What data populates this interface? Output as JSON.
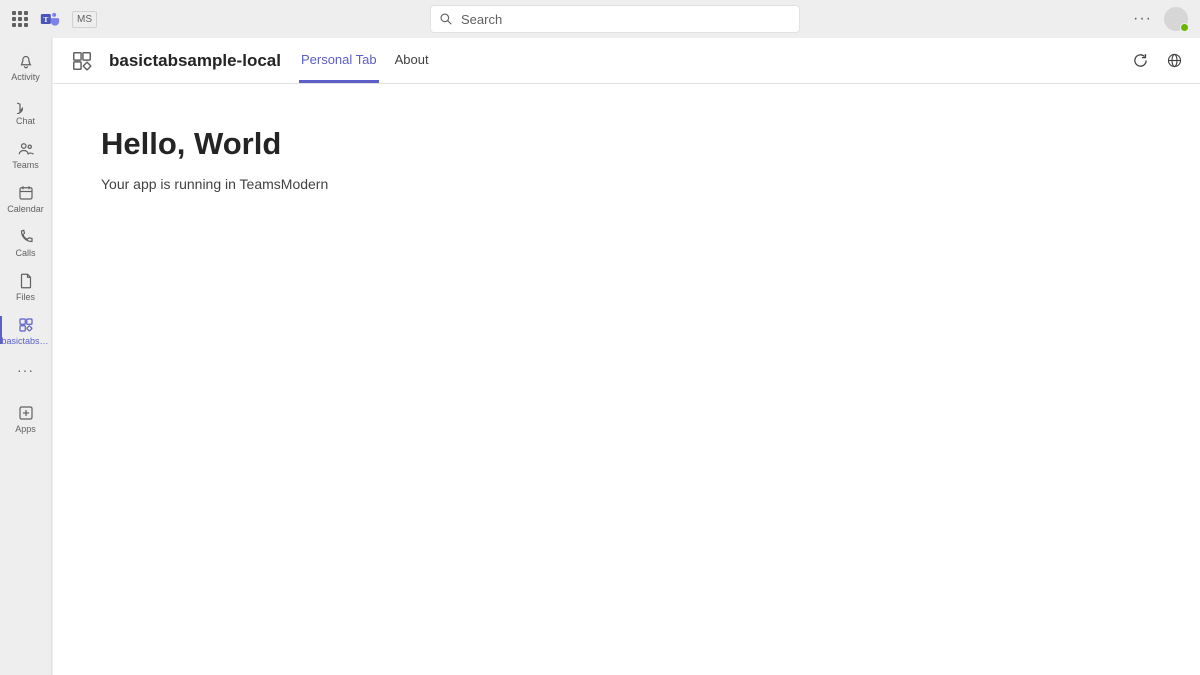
{
  "topbar": {
    "org_badge": "MS",
    "search_placeholder": "Search"
  },
  "rail": {
    "items": [
      {
        "label": "Activity"
      },
      {
        "label": "Chat"
      },
      {
        "label": "Teams"
      },
      {
        "label": "Calendar"
      },
      {
        "label": "Calls"
      },
      {
        "label": "Files"
      },
      {
        "label": "basictabsa..."
      }
    ],
    "apps_label": "Apps"
  },
  "header": {
    "app_title": "basictabsample-local",
    "tabs": [
      {
        "label": "Personal Tab",
        "active": true
      },
      {
        "label": "About",
        "active": false
      }
    ]
  },
  "content": {
    "heading": "Hello, World",
    "subtext": "Your app is running in TeamsModern"
  }
}
